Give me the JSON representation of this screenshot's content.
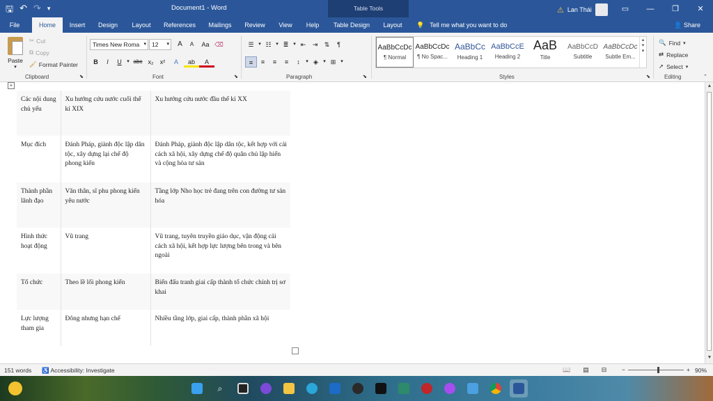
{
  "titlebar": {
    "document_title": "Document1  -  Word",
    "contextual_label": "Table Tools",
    "user_name": "Lan Thái",
    "qat_icons": [
      "save-icon",
      "undo-icon",
      "redo-icon",
      "customize-icon"
    ],
    "color": "#2b579a"
  },
  "tabs": [
    {
      "label": "File"
    },
    {
      "label": "Home"
    },
    {
      "label": "Insert"
    },
    {
      "label": "Design"
    },
    {
      "label": "Layout"
    },
    {
      "label": "References"
    },
    {
      "label": "Mailings"
    },
    {
      "label": "Review"
    },
    {
      "label": "View"
    },
    {
      "label": "Help"
    },
    {
      "label": "Table Design"
    },
    {
      "label": "Layout"
    }
  ],
  "tell_me": "Tell me what you want to do",
  "share": "Share",
  "ribbon": {
    "clipboard": {
      "label": "Clipboard",
      "paste": "Paste",
      "cut": "Cut",
      "copy": "Copy",
      "format_painter": "Format Painter"
    },
    "font": {
      "label": "Font",
      "font_name": "Times New Roma",
      "font_size": "12",
      "grow": "A",
      "shrink": "A",
      "change_case": "Aa",
      "bold": "B",
      "italic": "I",
      "underline": "U",
      "strike": "abc",
      "subscript": "x₂",
      "superscript": "x²",
      "text_effects": "A",
      "highlight": "ab",
      "font_color": "A"
    },
    "paragraph": {
      "label": "Paragraph"
    },
    "styles": {
      "label": "Styles",
      "items": [
        {
          "sample": "AaBbCcDc",
          "name": "¶ Normal"
        },
        {
          "sample": "AaBbCcDc",
          "name": "¶ No Spac..."
        },
        {
          "sample": "AaBbCc",
          "name": "Heading 1"
        },
        {
          "sample": "AaBbCcE",
          "name": "Heading 2"
        },
        {
          "sample": "AaB",
          "name": "Title"
        },
        {
          "sample": "AaBbCcD",
          "name": "Subtitle"
        },
        {
          "sample": "AaBbCcDc",
          "name": "Subtle Em..."
        }
      ]
    },
    "editing": {
      "label": "Editing",
      "find": "Find",
      "replace": "Replace",
      "select": "Select"
    }
  },
  "table": {
    "rows": [
      [
        "Các nội dung chủ yếu",
        "Xu hướng cứu nước cuối thế kỉ XIX",
        "Xu hướng cứu nước đầu thế kỉ XX"
      ],
      [
        "Mục đích",
        "Đánh Pháp, giành độc lập dân tộc, xây dựng lại chế độ phong kiến",
        "Đánh Pháp, giành độc lập dân tộc, kết hợp với cải cách xã hội, xây dựng chế độ quân chủ lập hiến và cộng hòa tư sản"
      ],
      [
        "Thành phần lãnh đạo",
        "Văn thân, sĩ phu phong kiến yêu nước",
        "Tầng lớp Nho học trẻ đang trên con đường tư sản hóa"
      ],
      [
        "Hình thức hoạt động",
        "Vũ trang",
        "Vũ trang, tuyên truyền giáo dục, vận động cải cách xã hội, kết hợp lực lượng bên trong và bên ngoài"
      ],
      [
        "Tổ chức",
        "Theo lề lối phong kiến",
        "Biến đấu tranh giai cấp thành tổ chức chính trị sơ khai"
      ],
      [
        "Lực lượng tham gia",
        "Đông nhưng hạn chế",
        "Nhiều tầng lớp, giai cấp, thành phần xã hội"
      ]
    ]
  },
  "statusbar": {
    "word_count": "151 words",
    "accessibility": "Accessibility: Investigate",
    "zoom": "90%",
    "zoom_out": "−",
    "zoom_in": "+"
  },
  "taskbar": {
    "icons": [
      "windows-start-icon",
      "search-icon",
      "task-view-icon",
      "zoom-icon",
      "file-explorer-icon",
      "edge-icon",
      "store-icon",
      "app-icon",
      "tiktok-icon",
      "app-icon-2",
      "app-icon-3",
      "messenger-icon",
      "photos-icon",
      "chrome-icon",
      "word-icon"
    ]
  }
}
